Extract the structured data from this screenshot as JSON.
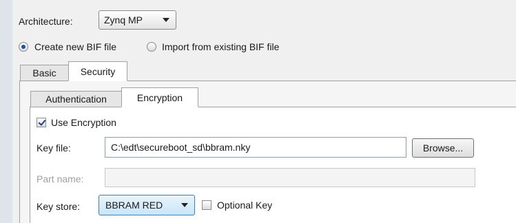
{
  "architecture": {
    "label": "Architecture:",
    "selected": "Zynq MP"
  },
  "bif_mode": {
    "create_label": "Create new BIF file",
    "create_selected": true,
    "import_label": "Import from existing BIF file",
    "import_selected": false
  },
  "outer_tabs": [
    {
      "label": "Basic",
      "active": false
    },
    {
      "label": "Security",
      "active": true
    }
  ],
  "inner_tabs": [
    {
      "label": "Authentication",
      "active": false
    },
    {
      "label": "Encryption",
      "active": true
    }
  ],
  "encryption": {
    "use_encryption_label": "Use Encryption",
    "use_encryption_checked": true,
    "key_file_label": "Key file:",
    "key_file_value": "C:\\edt\\secureboot_sd\\bbram.nky",
    "browse_label": "Browse...",
    "part_name_label": "Part name:",
    "part_name_value": "",
    "part_name_enabled": false,
    "key_store_label": "Key store:",
    "key_store_selected": "BBRAM RED",
    "optional_key_label": "Optional Key",
    "optional_key_checked": false
  }
}
